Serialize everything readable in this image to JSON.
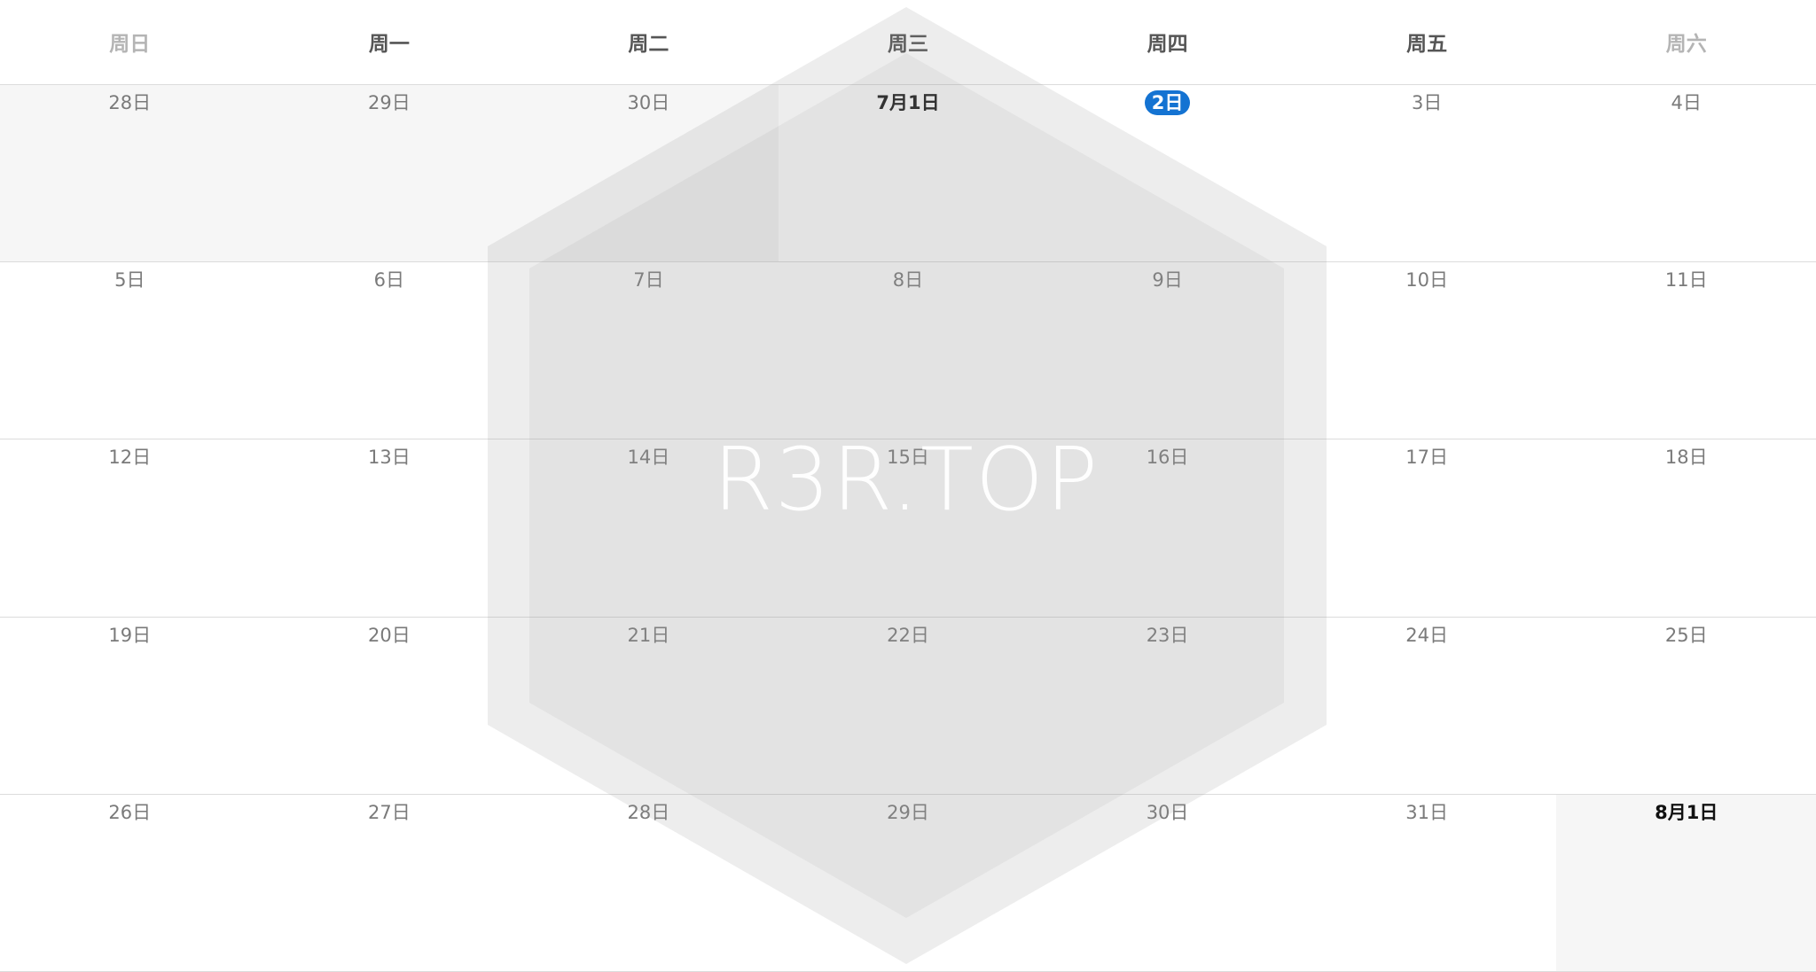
{
  "weekdays": [
    "周日",
    "周一",
    "周二",
    "周三",
    "周四",
    "周五",
    "周六"
  ],
  "weeks": [
    [
      {
        "label": "28日",
        "state": "out-of-month"
      },
      {
        "label": "29日",
        "state": "out-of-month"
      },
      {
        "label": "30日",
        "state": "out-of-month"
      },
      {
        "label": "7月1日",
        "state": "month-start"
      },
      {
        "label": "2日",
        "state": "today"
      },
      {
        "label": "3日",
        "state": "normal"
      },
      {
        "label": "4日",
        "state": "normal"
      }
    ],
    [
      {
        "label": "5日",
        "state": "normal"
      },
      {
        "label": "6日",
        "state": "normal"
      },
      {
        "label": "7日",
        "state": "normal"
      },
      {
        "label": "8日",
        "state": "normal"
      },
      {
        "label": "9日",
        "state": "normal"
      },
      {
        "label": "10日",
        "state": "normal"
      },
      {
        "label": "11日",
        "state": "normal"
      }
    ],
    [
      {
        "label": "12日",
        "state": "normal"
      },
      {
        "label": "13日",
        "state": "normal"
      },
      {
        "label": "14日",
        "state": "normal"
      },
      {
        "label": "15日",
        "state": "normal"
      },
      {
        "label": "16日",
        "state": "normal"
      },
      {
        "label": "17日",
        "state": "normal"
      },
      {
        "label": "18日",
        "state": "normal"
      }
    ],
    [
      {
        "label": "19日",
        "state": "normal"
      },
      {
        "label": "20日",
        "state": "normal"
      },
      {
        "label": "21日",
        "state": "normal"
      },
      {
        "label": "22日",
        "state": "normal"
      },
      {
        "label": "23日",
        "state": "normal"
      },
      {
        "label": "24日",
        "state": "normal"
      },
      {
        "label": "25日",
        "state": "normal"
      }
    ],
    [
      {
        "label": "26日",
        "state": "normal"
      },
      {
        "label": "27日",
        "state": "normal"
      },
      {
        "label": "28日",
        "state": "normal"
      },
      {
        "label": "29日",
        "state": "normal"
      },
      {
        "label": "30日",
        "state": "normal"
      },
      {
        "label": "31日",
        "state": "normal"
      },
      {
        "label": "8月1日",
        "state": "out-of-month-start"
      }
    ]
  ],
  "watermark": {
    "text": "R3R.TOP"
  },
  "colors": {
    "today_accent": "#1473d2",
    "out_of_month_bg": "#f6f6f6",
    "gridline": "#dcdcdc"
  }
}
